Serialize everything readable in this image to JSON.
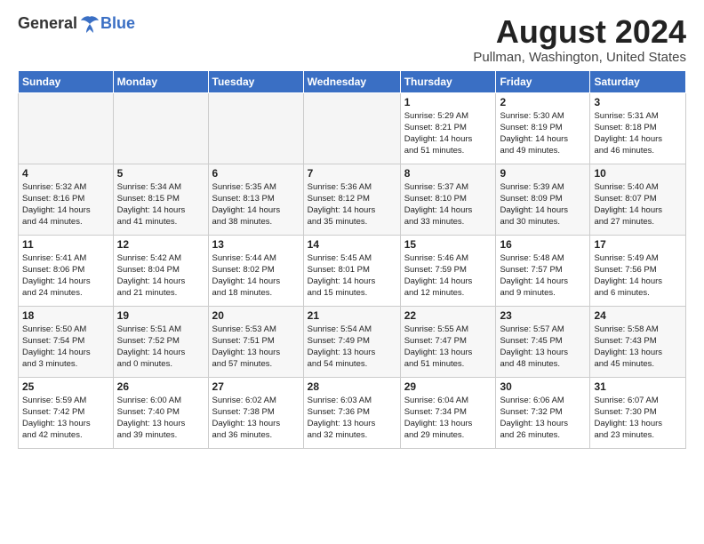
{
  "header": {
    "logo_general": "General",
    "logo_blue": "Blue",
    "title": "August 2024",
    "location": "Pullman, Washington, United States"
  },
  "days_of_week": [
    "Sunday",
    "Monday",
    "Tuesday",
    "Wednesday",
    "Thursday",
    "Friday",
    "Saturday"
  ],
  "weeks": [
    [
      {
        "day": "",
        "info": "",
        "empty": true
      },
      {
        "day": "",
        "info": "",
        "empty": true
      },
      {
        "day": "",
        "info": "",
        "empty": true
      },
      {
        "day": "",
        "info": "",
        "empty": true
      },
      {
        "day": "1",
        "info": "Sunrise: 5:29 AM\nSunset: 8:21 PM\nDaylight: 14 hours\nand 51 minutes.",
        "empty": false
      },
      {
        "day": "2",
        "info": "Sunrise: 5:30 AM\nSunset: 8:19 PM\nDaylight: 14 hours\nand 49 minutes.",
        "empty": false
      },
      {
        "day": "3",
        "info": "Sunrise: 5:31 AM\nSunset: 8:18 PM\nDaylight: 14 hours\nand 46 minutes.",
        "empty": false
      }
    ],
    [
      {
        "day": "4",
        "info": "Sunrise: 5:32 AM\nSunset: 8:16 PM\nDaylight: 14 hours\nand 44 minutes.",
        "empty": false
      },
      {
        "day": "5",
        "info": "Sunrise: 5:34 AM\nSunset: 8:15 PM\nDaylight: 14 hours\nand 41 minutes.",
        "empty": false
      },
      {
        "day": "6",
        "info": "Sunrise: 5:35 AM\nSunset: 8:13 PM\nDaylight: 14 hours\nand 38 minutes.",
        "empty": false
      },
      {
        "day": "7",
        "info": "Sunrise: 5:36 AM\nSunset: 8:12 PM\nDaylight: 14 hours\nand 35 minutes.",
        "empty": false
      },
      {
        "day": "8",
        "info": "Sunrise: 5:37 AM\nSunset: 8:10 PM\nDaylight: 14 hours\nand 33 minutes.",
        "empty": false
      },
      {
        "day": "9",
        "info": "Sunrise: 5:39 AM\nSunset: 8:09 PM\nDaylight: 14 hours\nand 30 minutes.",
        "empty": false
      },
      {
        "day": "10",
        "info": "Sunrise: 5:40 AM\nSunset: 8:07 PM\nDaylight: 14 hours\nand 27 minutes.",
        "empty": false
      }
    ],
    [
      {
        "day": "11",
        "info": "Sunrise: 5:41 AM\nSunset: 8:06 PM\nDaylight: 14 hours\nand 24 minutes.",
        "empty": false
      },
      {
        "day": "12",
        "info": "Sunrise: 5:42 AM\nSunset: 8:04 PM\nDaylight: 14 hours\nand 21 minutes.",
        "empty": false
      },
      {
        "day": "13",
        "info": "Sunrise: 5:44 AM\nSunset: 8:02 PM\nDaylight: 14 hours\nand 18 minutes.",
        "empty": false
      },
      {
        "day": "14",
        "info": "Sunrise: 5:45 AM\nSunset: 8:01 PM\nDaylight: 14 hours\nand 15 minutes.",
        "empty": false
      },
      {
        "day": "15",
        "info": "Sunrise: 5:46 AM\nSunset: 7:59 PM\nDaylight: 14 hours\nand 12 minutes.",
        "empty": false
      },
      {
        "day": "16",
        "info": "Sunrise: 5:48 AM\nSunset: 7:57 PM\nDaylight: 14 hours\nand 9 minutes.",
        "empty": false
      },
      {
        "day": "17",
        "info": "Sunrise: 5:49 AM\nSunset: 7:56 PM\nDaylight: 14 hours\nand 6 minutes.",
        "empty": false
      }
    ],
    [
      {
        "day": "18",
        "info": "Sunrise: 5:50 AM\nSunset: 7:54 PM\nDaylight: 14 hours\nand 3 minutes.",
        "empty": false
      },
      {
        "day": "19",
        "info": "Sunrise: 5:51 AM\nSunset: 7:52 PM\nDaylight: 14 hours\nand 0 minutes.",
        "empty": false
      },
      {
        "day": "20",
        "info": "Sunrise: 5:53 AM\nSunset: 7:51 PM\nDaylight: 13 hours\nand 57 minutes.",
        "empty": false
      },
      {
        "day": "21",
        "info": "Sunrise: 5:54 AM\nSunset: 7:49 PM\nDaylight: 13 hours\nand 54 minutes.",
        "empty": false
      },
      {
        "day": "22",
        "info": "Sunrise: 5:55 AM\nSunset: 7:47 PM\nDaylight: 13 hours\nand 51 minutes.",
        "empty": false
      },
      {
        "day": "23",
        "info": "Sunrise: 5:57 AM\nSunset: 7:45 PM\nDaylight: 13 hours\nand 48 minutes.",
        "empty": false
      },
      {
        "day": "24",
        "info": "Sunrise: 5:58 AM\nSunset: 7:43 PM\nDaylight: 13 hours\nand 45 minutes.",
        "empty": false
      }
    ],
    [
      {
        "day": "25",
        "info": "Sunrise: 5:59 AM\nSunset: 7:42 PM\nDaylight: 13 hours\nand 42 minutes.",
        "empty": false
      },
      {
        "day": "26",
        "info": "Sunrise: 6:00 AM\nSunset: 7:40 PM\nDaylight: 13 hours\nand 39 minutes.",
        "empty": false
      },
      {
        "day": "27",
        "info": "Sunrise: 6:02 AM\nSunset: 7:38 PM\nDaylight: 13 hours\nand 36 minutes.",
        "empty": false
      },
      {
        "day": "28",
        "info": "Sunrise: 6:03 AM\nSunset: 7:36 PM\nDaylight: 13 hours\nand 32 minutes.",
        "empty": false
      },
      {
        "day": "29",
        "info": "Sunrise: 6:04 AM\nSunset: 7:34 PM\nDaylight: 13 hours\nand 29 minutes.",
        "empty": false
      },
      {
        "day": "30",
        "info": "Sunrise: 6:06 AM\nSunset: 7:32 PM\nDaylight: 13 hours\nand 26 minutes.",
        "empty": false
      },
      {
        "day": "31",
        "info": "Sunrise: 6:07 AM\nSunset: 7:30 PM\nDaylight: 13 hours\nand 23 minutes.",
        "empty": false
      }
    ]
  ]
}
